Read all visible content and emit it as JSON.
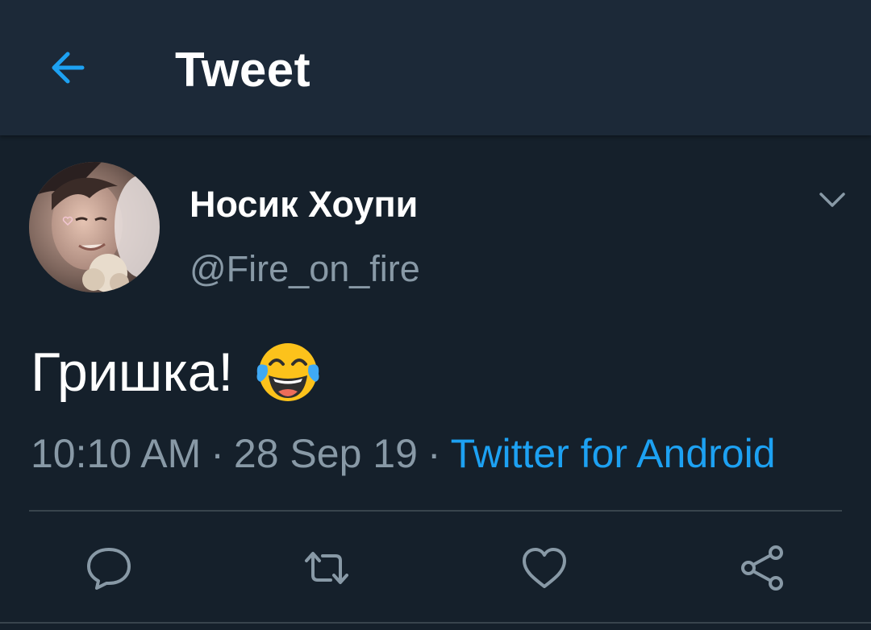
{
  "header": {
    "title": "Tweet",
    "back_icon": "arrow-left-icon"
  },
  "tweet": {
    "author_name": "Носик Хоупи",
    "author_handle": "@Fire_on_fire",
    "text": "Гришка!",
    "emoji": "face-with-tears-of-joy",
    "time": "10:10 AM",
    "date": "28 Sep 19",
    "separator": "·",
    "source": "Twitter for Android"
  },
  "actions": [
    {
      "name": "reply",
      "icon": "comment-icon"
    },
    {
      "name": "retweet",
      "icon": "retweet-icon"
    },
    {
      "name": "like",
      "icon": "heart-icon"
    },
    {
      "name": "share",
      "icon": "share-icon"
    }
  ],
  "colors": {
    "background": "#15202b",
    "header": "#1c2938",
    "accent": "#1da1f2",
    "secondary_text": "#8899a6",
    "divider": "#38444d"
  }
}
